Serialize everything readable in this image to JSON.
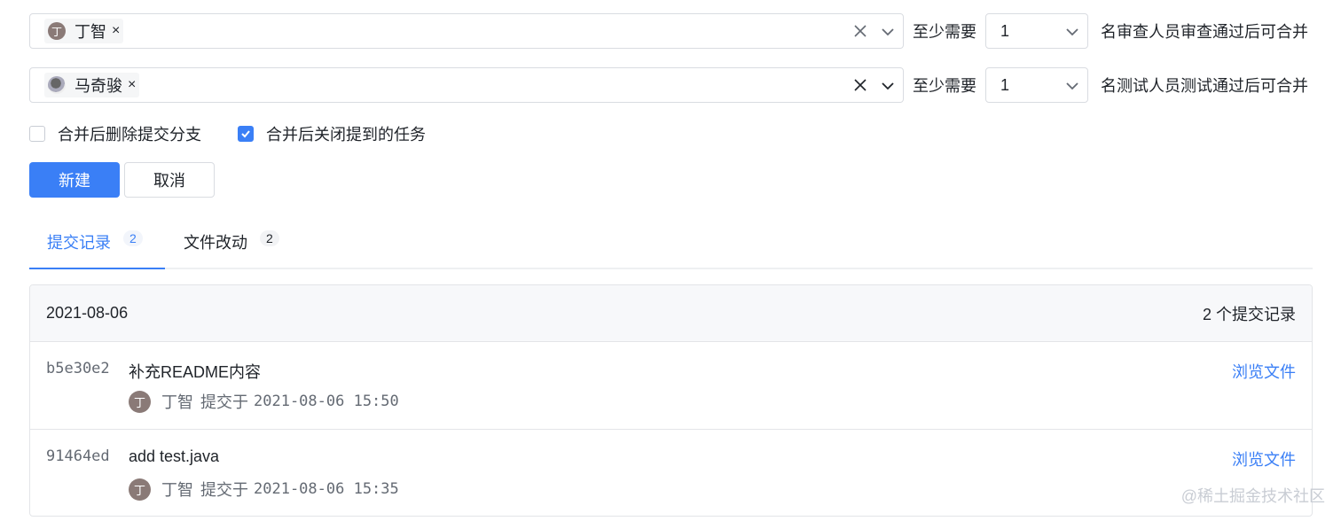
{
  "reviewers": {
    "selected": [
      {
        "avatar_initial": "丁",
        "name": "丁智"
      }
    ],
    "at_least_label": "至少需要",
    "count": "1",
    "suffix": "名审查人员审查通过后可合并"
  },
  "testers": {
    "selected": [
      {
        "avatar_initial": "",
        "name": "马奇骏"
      }
    ],
    "at_least_label": "至少需要",
    "count": "1",
    "suffix": "名测试人员测试通过后可合并"
  },
  "options": {
    "delete_branch_label": "合并后删除提交分支",
    "delete_branch_checked": false,
    "close_tasks_label": "合并后关闭提到的任务",
    "close_tasks_checked": true
  },
  "actions": {
    "create_label": "新建",
    "cancel_label": "取消"
  },
  "tabs": [
    {
      "label": "提交记录",
      "count": "2",
      "active": true
    },
    {
      "label": "文件改动",
      "count": "2",
      "active": false
    }
  ],
  "commits_panel": {
    "date": "2021-08-06",
    "summary": "2 个提交记录",
    "commits": [
      {
        "sha": "b5e30e2",
        "message": "补充README内容",
        "author_initial": "丁",
        "author": "丁智",
        "action": "提交于",
        "time": "2021-08-06 15:50",
        "browse_label": "浏览文件"
      },
      {
        "sha": "91464ed",
        "message": "add test.java",
        "author_initial": "丁",
        "author": "丁智",
        "action": "提交于",
        "time": "2021-08-06 15:35",
        "browse_label": "浏览文件"
      }
    ]
  },
  "watermark": "@稀土掘金技术社区",
  "colors": {
    "primary": "#3a7ff6",
    "border": "#d9dce1",
    "muted": "#646a73"
  }
}
